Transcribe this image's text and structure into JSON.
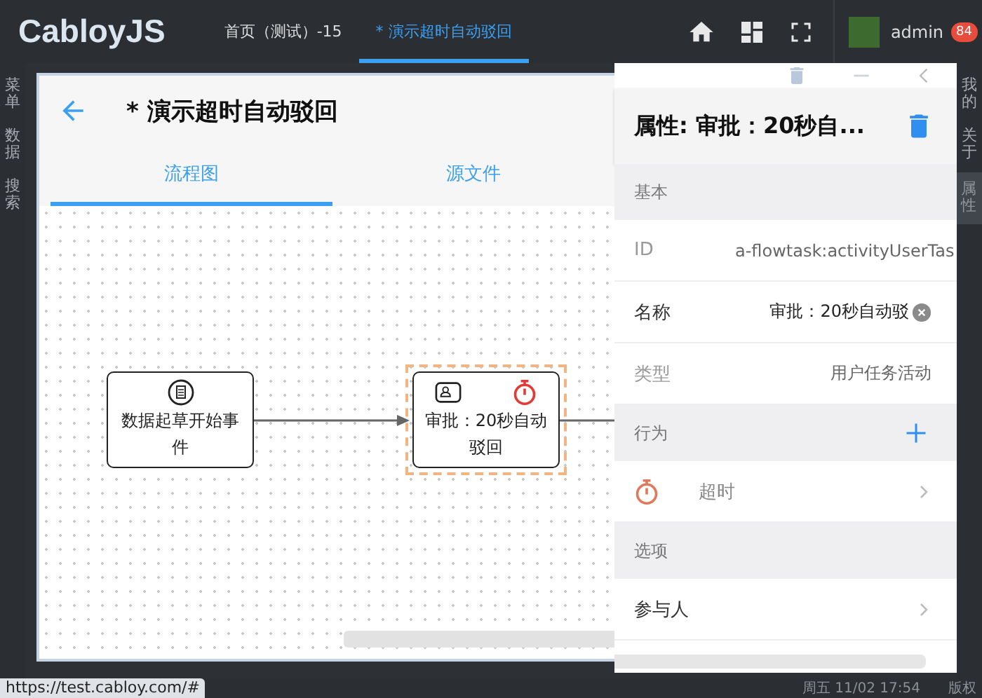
{
  "app": {
    "logo": "CabloyJS"
  },
  "top_tabs": [
    {
      "label": "首页（测试）-15",
      "selected": false
    },
    {
      "label": "* 演示超时自动驳回",
      "selected": true
    }
  ],
  "user": {
    "name": "admin",
    "badge": "84"
  },
  "left_rail": [
    {
      "label": "菜单",
      "selected": false
    },
    {
      "label": "数据",
      "selected": false
    },
    {
      "label": "搜索",
      "selected": false
    }
  ],
  "right_rail": [
    {
      "label": "我的",
      "selected": false
    },
    {
      "label": "关于",
      "selected": false
    },
    {
      "label": "属性",
      "selected": true
    }
  ],
  "page": {
    "title": "* 演示超时自动驳回",
    "tabs": [
      {
        "label": "流程图",
        "selected": true
      },
      {
        "label": "源文件",
        "selected": false
      }
    ]
  },
  "diagram": {
    "nodes": [
      {
        "kind": "start",
        "label": "数据起草开始事件",
        "selected": false
      },
      {
        "kind": "task",
        "label": "审批：20秒自动驳回",
        "selected": true
      }
    ]
  },
  "properties": {
    "title": "属性: 审批：20秒自...",
    "groups": [
      {
        "title": "基本",
        "addable": false,
        "rows": [
          {
            "kind": "text",
            "label": "ID",
            "value": "a-flowtask:activityUserTas"
          },
          {
            "kind": "input",
            "label": "名称",
            "value": "审批：20秒自动驳"
          },
          {
            "kind": "text",
            "label": "类型",
            "value": "用户任务活动"
          }
        ]
      },
      {
        "title": "行为",
        "addable": true,
        "rows": [
          {
            "kind": "timer",
            "label": "超时"
          }
        ]
      },
      {
        "title": "选项",
        "addable": false,
        "rows": [
          {
            "kind": "link",
            "label": "参与人"
          }
        ]
      }
    ]
  },
  "status_bar": {
    "url": "https://test.cabloy.com/#",
    "time": "周五 11/02 17:54",
    "copyright": "版权"
  }
}
